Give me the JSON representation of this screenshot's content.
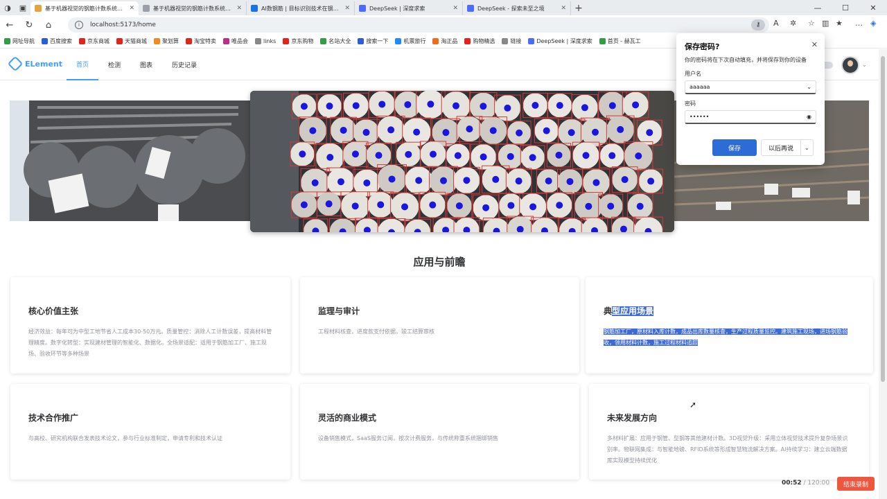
{
  "browser": {
    "tabs": [
      {
        "title": "基于机器视觉的钢筋计数系统算法",
        "active": true,
        "color": "#e8a33d"
      },
      {
        "title": "基于机器视觉的钢筋计数系统算法",
        "active": false,
        "color": "#9aa0a6"
      },
      {
        "title": "AI数钢筋 | 目标识别技术在钢筋计",
        "active": false,
        "color": "#1a73e8"
      },
      {
        "title": "DeepSeek | 深度求索",
        "active": false,
        "color": "#4d6bfe"
      },
      {
        "title": "DeepSeek - 探索未至之境",
        "active": false,
        "color": "#4d6bfe"
      }
    ],
    "url": "localhost:5173/home",
    "bookmarks": [
      {
        "label": "网址导航",
        "color": "#2f9e44"
      },
      {
        "label": "百度搜索",
        "color": "#2b5fd9"
      },
      {
        "label": "京东商城",
        "color": "#e1251b"
      },
      {
        "label": "天猫商城",
        "color": "#e1251b"
      },
      {
        "label": "聚划算",
        "color": "#f08a24"
      },
      {
        "label": "淘宝特卖",
        "color": "#e1251b"
      },
      {
        "label": "唯品会",
        "color": "#c02c89"
      },
      {
        "label": "links",
        "color": "#888888"
      },
      {
        "label": "京东购物",
        "color": "#e1251b"
      },
      {
        "label": "名站大全",
        "color": "#2f9e44"
      },
      {
        "label": "搜索一下",
        "color": "#2b5fd9"
      },
      {
        "label": "机票旅行",
        "color": "#1a8cff"
      },
      {
        "label": "淘正品",
        "color": "#f26b1d"
      },
      {
        "label": "购物精选",
        "color": "#e1251b"
      },
      {
        "label": "链接",
        "color": "#888888"
      },
      {
        "label": "DeepSeek | 深度求索",
        "color": "#4d6bfe"
      },
      {
        "label": "首页 - 赫瓦工",
        "color": "#2f9e44"
      }
    ]
  },
  "app": {
    "logo": "ELement",
    "menu": [
      "首页",
      "检测",
      "图表",
      "历史记录"
    ],
    "section_title": "应用与前瞻",
    "cards": [
      {
        "title": "核心价值主张",
        "desc": "经济效益：每年可为中型工地节省人工成本30-50万元。质量管控：消除人工计数误差，提高材料管理精度。数字化转型：实现建材管理的智能化、数据化。全场景适配：适用于钢筋加工厂、施工现场、验收环节等多种场景"
      },
      {
        "title": "监理与审计",
        "desc": "工程材料核查，进度款支付依据，竣工结算审核"
      },
      {
        "title_pre": "典",
        "title_hl": "型应用场景",
        "desc": "钢筋加工厂，原材料入库计数，成品出库数量核查，生产过程质量监控。建筑施工现场，进场钢筋验收，领用材料计数，施工过程材料追踪"
      },
      {
        "title": "技术合作推广",
        "desc": "与高校、研究机构联合发表技术论文，参与行业标准制定，申请专利和技术认证"
      },
      {
        "title": "灵活的商业模式",
        "desc": "设备销售模式，SaaS服务订阅，按次计费服务，与传统称重系统捆绑销售"
      },
      {
        "title": "未来发展方向",
        "desc": "多材料扩展：应用于钢管、型钢等其他建材计数。3D视觉升级：采用立体视觉技术提升复杂场景识别率。物联网集成：与智能地磅、RFID系统等形成智慧物流解决方案。AI持续学习：建立云端数据库实现模型持续优化"
      }
    ]
  },
  "save_password": {
    "title": "保存密码?",
    "desc": "你的密码将在下次自动填充，并将保存到你的设备",
    "username_label": "用户名",
    "username_value": "aaaaaa",
    "password_label": "密码",
    "password_value": "••••••",
    "save": "保存",
    "later": "以后再说"
  },
  "recorder": {
    "elapsed": "00:52",
    "total": "/ 120:00",
    "stop": "结束录制"
  }
}
